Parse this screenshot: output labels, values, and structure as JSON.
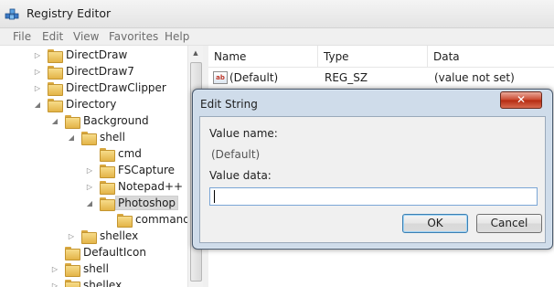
{
  "window": {
    "title": "Registry Editor"
  },
  "menu": [
    "File",
    "Edit",
    "View",
    "Favorites",
    "Help"
  ],
  "tree": {
    "rows": [
      {
        "label": "DirectDraw",
        "expander": "▷"
      },
      {
        "label": "DirectDraw7",
        "expander": "▷"
      },
      {
        "label": "DirectDrawClipper",
        "expander": "▷"
      },
      {
        "label": "Directory",
        "expander": "◢"
      },
      {
        "label": "Background",
        "expander": "◢"
      },
      {
        "label": "shell",
        "expander": "◢"
      },
      {
        "label": "cmd",
        "expander": ""
      },
      {
        "label": "FSCapture",
        "expander": "▷"
      },
      {
        "label": "Notepad++",
        "expander": "▷"
      },
      {
        "label": "Photoshop",
        "expander": "◢"
      },
      {
        "label": "command",
        "expander": ""
      },
      {
        "label": "shellex",
        "expander": "▷"
      },
      {
        "label": "DefaultIcon",
        "expander": ""
      },
      {
        "label": "shell",
        "expander": "▷"
      },
      {
        "label": "shellex",
        "expander": "▷"
      }
    ]
  },
  "list": {
    "columns": [
      "Name",
      "Type",
      "Data"
    ],
    "rows": [
      {
        "name": "(Default)",
        "type": "REG_SZ",
        "data": "(value not set)"
      }
    ]
  },
  "dialog": {
    "title": "Edit String",
    "value_name_label": "Value name:",
    "value_name": "(Default)",
    "value_data_label": "Value data:",
    "value_data": "",
    "ok_label": "OK",
    "cancel_label": "Cancel",
    "close_glyph": "✕"
  },
  "scrollbar": {
    "up_glyph": "▲"
  },
  "icons": {
    "string_value_icon": "ab"
  }
}
